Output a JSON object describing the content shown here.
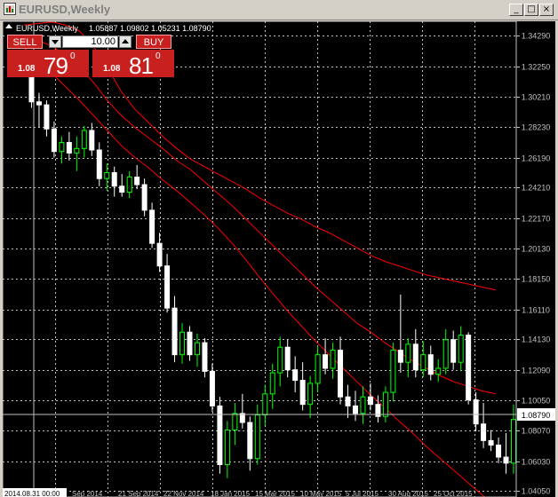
{
  "window": {
    "title": "EURUSD,Weekly",
    "buttons": [
      "_",
      "□",
      "×"
    ]
  },
  "chart_header": {
    "symbol": "EURUSD,Weekly",
    "ohlc": "1.05887 1.09802 1.05231 1.08790"
  },
  "trade_panel": {
    "sell_label": "SELL",
    "buy_label": "BUY",
    "lot_value": "10.00",
    "sell_price": {
      "small": "1.08",
      "big": "79",
      "sup": "0"
    },
    "buy_price": {
      "small": "1.08",
      "big": "81",
      "sup": "0"
    }
  },
  "price_scale": [
    "1.34290",
    "1.32250",
    "1.30210",
    "1.28230",
    "1.26190",
    "1.24210",
    "1.22170",
    "1.20130",
    "1.18150",
    "1.16110",
    "1.14130",
    "1.12090",
    "1.10050",
    "1.08070",
    "1.06030",
    "1.04050"
  ],
  "current_price": "1.08790",
  "time_scale": [
    "21 Sep 2014",
    "22 Nov 2014",
    "18 Jan 2015",
    "15 Mar 2015",
    "10 May 2015",
    "5 Jul 2015",
    "30 Aug 2015",
    "25 Oct 2015"
  ],
  "time_scale_visible": [
    "2014.08.31 00:00",
    "Sep 2014"
  ],
  "colors": {
    "background": "#000000",
    "grid": "#c0c0c0",
    "bull_candle": "#00ff00",
    "bear_candle": "#ffffff",
    "bands": "#ff0000",
    "panel_red": "#c8201e"
  },
  "chart_data": {
    "type": "candlestick",
    "ylim": [
      1.0365,
      1.3525
    ],
    "bands_series": [
      {
        "values": [
          1.335,
          1.327,
          1.318,
          1.309,
          1.3,
          1.29,
          1.28,
          1.27,
          1.262,
          1.255,
          1.247,
          1.24,
          1.232,
          1.224,
          1.215,
          1.205,
          1.194,
          1.182,
          1.171,
          1.16,
          1.15,
          1.14,
          1.131,
          1.122,
          1.113,
          1.104,
          1.096,
          1.087,
          1.079,
          1.07,
          1.062,
          1.054,
          1.046,
          1.038,
          1.03
        ]
      },
      {
        "values": [
          1.342,
          1.34,
          1.336,
          1.33,
          1.322,
          1.312,
          1.3,
          1.29,
          1.282,
          1.275,
          1.268,
          1.26,
          1.254,
          1.246,
          1.238,
          1.23,
          1.221,
          1.212,
          1.203,
          1.194,
          1.185,
          1.176,
          1.168,
          1.16,
          1.152,
          1.146,
          1.139,
          1.133,
          1.127,
          1.122,
          1.117,
          1.113,
          1.11,
          1.107,
          1.105
        ]
      },
      {
        "values": [
          1.35,
          1.351,
          1.352,
          1.35,
          1.346,
          1.336,
          1.322,
          1.306,
          1.294,
          1.285,
          1.276,
          1.268,
          1.261,
          1.256,
          1.251,
          1.246,
          1.241,
          1.235,
          1.23,
          1.225,
          1.221,
          1.216,
          1.212,
          1.207,
          1.202,
          1.197,
          1.193,
          1.19,
          1.187,
          1.184,
          1.182,
          1.18,
          1.178,
          1.176,
          1.174
        ]
      }
    ]
  }
}
